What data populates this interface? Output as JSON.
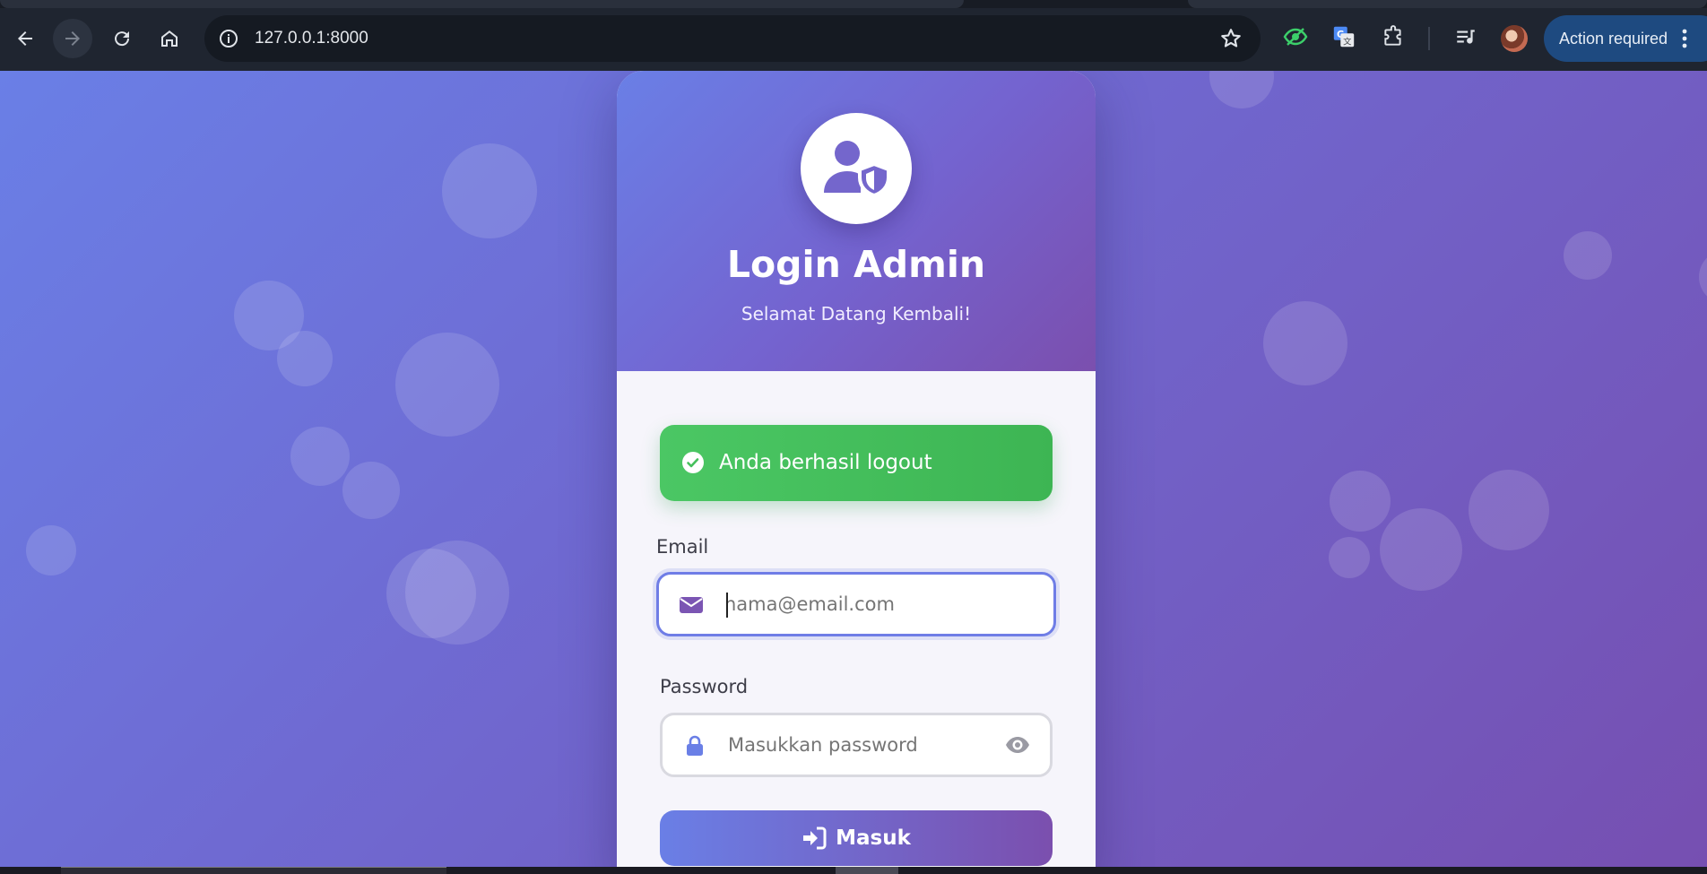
{
  "browser": {
    "url": "127.0.0.1:8000",
    "action_label": "Action required"
  },
  "icons": {
    "back": "back-arrow-icon",
    "forward": "forward-arrow-icon",
    "reload": "reload-icon",
    "home": "home-icon",
    "site_info": "info-icon",
    "bookmark": "star-icon",
    "eye_extension": "eye-slash-icon",
    "translate": "translate-icon",
    "extensions": "puzzle-icon",
    "media": "playlist-icon",
    "menu": "kebab-menu-icon"
  },
  "login": {
    "title": "Login Admin",
    "subtitle": "Selamat Datang Kembali!",
    "alert": "Anda berhasil logout",
    "email_label": "Email",
    "email_placeholder": "nama@email.com",
    "password_label": "Password",
    "password_placeholder": "Masukkan password",
    "submit_label": "Masuk"
  },
  "colors": {
    "accent_start": "#6a7fe6",
    "accent_end": "#7b4fae",
    "success": "#45c05c",
    "chrome_bg": "#1f2530"
  }
}
